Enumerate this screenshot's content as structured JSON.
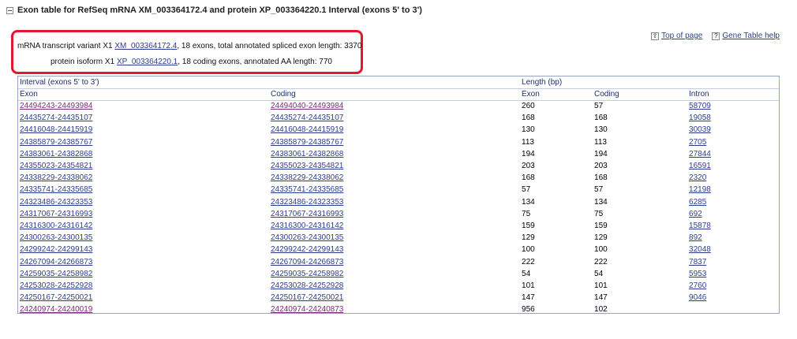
{
  "section": {
    "title": "Exon table for RefSeq mRNA XM_003364172.4 and protein XP_003364220.1 Interval (exons 5' to 3')"
  },
  "summary": {
    "mrna_prefix": "mRNA transcript variant X1",
    "mrna_accession": "XM_003364172.4",
    "mrna_suffix": ", 18 exons, total annotated spliced exon length: 3370",
    "protein_prefix": "protein isoform X1",
    "protein_accession": "XP_003364220.1",
    "protein_suffix": ", 18 coding exons, annotated AA length: 770"
  },
  "top_links": {
    "top_icon": "⇧",
    "top_label": "Top of page",
    "help_icon": "?",
    "help_label": "Gene Table help"
  },
  "table": {
    "group_interval": "Interval (exons 5' to 3')",
    "group_length": "Length (bp)",
    "col_exon": "Exon",
    "col_coding": "Coding",
    "col_len_exon": "Exon",
    "col_len_coding": "Coding",
    "col_intron": "Intron",
    "rows": [
      {
        "exon": "24494243-24493984",
        "coding": "24494040-24493984",
        "len_exon": "260",
        "len_coding": "57",
        "intron": "58709",
        "visited": true
      },
      {
        "exon": "24435274-24435107",
        "coding": "24435274-24435107",
        "len_exon": "168",
        "len_coding": "168",
        "intron": "19058",
        "visited": false
      },
      {
        "exon": "24416048-24415919",
        "coding": "24416048-24415919",
        "len_exon": "130",
        "len_coding": "130",
        "intron": "30039",
        "visited": false
      },
      {
        "exon": "24385879-24385767",
        "coding": "24385879-24385767",
        "len_exon": "113",
        "len_coding": "113",
        "intron": "2705",
        "visited": false
      },
      {
        "exon": "24383061-24382868",
        "coding": "24383061-24382868",
        "len_exon": "194",
        "len_coding": "194",
        "intron": "27844",
        "visited": false
      },
      {
        "exon": "24355023-24354821",
        "coding": "24355023-24354821",
        "len_exon": "203",
        "len_coding": "203",
        "intron": "16591",
        "visited": false
      },
      {
        "exon": "24338229-24338062",
        "coding": "24338229-24338062",
        "len_exon": "168",
        "len_coding": "168",
        "intron": "2320",
        "visited": false
      },
      {
        "exon": "24335741-24335685",
        "coding": "24335741-24335685",
        "len_exon": "57",
        "len_coding": "57",
        "intron": "12198",
        "visited": false
      },
      {
        "exon": "24323486-24323353",
        "coding": "24323486-24323353",
        "len_exon": "134",
        "len_coding": "134",
        "intron": "6285",
        "visited": false
      },
      {
        "exon": "24317067-24316993",
        "coding": "24317067-24316993",
        "len_exon": "75",
        "len_coding": "75",
        "intron": "692",
        "visited": false
      },
      {
        "exon": "24316300-24316142",
        "coding": "24316300-24316142",
        "len_exon": "159",
        "len_coding": "159",
        "intron": "15878",
        "visited": false
      },
      {
        "exon": "24300263-24300135",
        "coding": "24300263-24300135",
        "len_exon": "129",
        "len_coding": "129",
        "intron": "892",
        "visited": false
      },
      {
        "exon": "24299242-24299143",
        "coding": "24299242-24299143",
        "len_exon": "100",
        "len_coding": "100",
        "intron": "32048",
        "visited": false
      },
      {
        "exon": "24267094-24266873",
        "coding": "24267094-24266873",
        "len_exon": "222",
        "len_coding": "222",
        "intron": "7837",
        "visited": false
      },
      {
        "exon": "24259035-24258982",
        "coding": "24259035-24258982",
        "len_exon": "54",
        "len_coding": "54",
        "intron": "5953",
        "visited": false
      },
      {
        "exon": "24253028-24252928",
        "coding": "24253028-24252928",
        "len_exon": "101",
        "len_coding": "101",
        "intron": "2760",
        "visited": false
      },
      {
        "exon": "24250167-24250021",
        "coding": "24250167-24250021",
        "len_exon": "147",
        "len_coding": "147",
        "intron": "9046",
        "visited": false
      },
      {
        "exon": "24240974-24240019",
        "coding": "24240974-24240873",
        "len_exon": "956",
        "len_coding": "102",
        "intron": "",
        "visited": true
      }
    ]
  },
  "colors": {
    "highlight": "#e3182d",
    "link": "#2c3d8f",
    "visited_link": "#7a2a7a"
  }
}
